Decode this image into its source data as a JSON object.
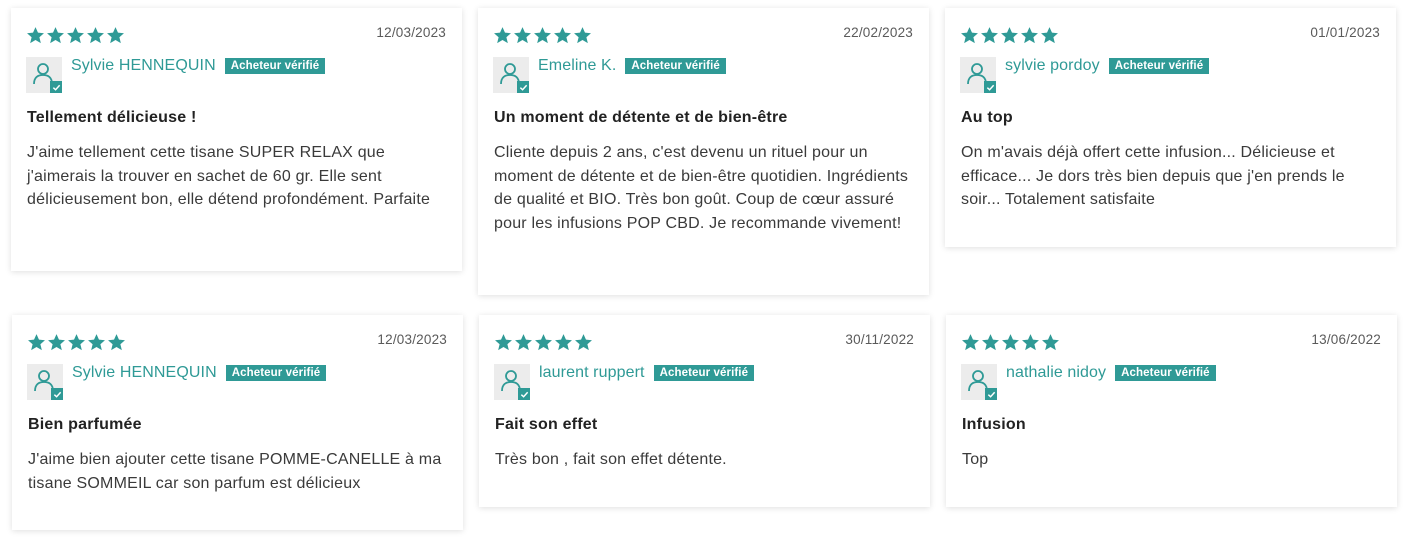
{
  "colors": {
    "accent": "#2f9a96",
    "star": "#2f9a96"
  },
  "badge_label": "Acheteur vérifié",
  "reviews": [
    {
      "rating": 5,
      "date": "12/03/2023",
      "author": "Sylvie HENNEQUIN",
      "title": "Tellement délicieuse !",
      "body": "J'aime tellement cette tisane SUPER RELAX que j'aimerais la trouver en sachet de 60 gr. Elle sent délicieusement bon, elle détend profondément. Parfaite"
    },
    {
      "rating": 5,
      "date": "22/02/2023",
      "author": "Emeline K.",
      "title": "Un moment de détente et de bien-être",
      "body": "Cliente depuis 2 ans, c'est devenu un rituel pour un moment de détente et de bien-être quotidien. Ingrédients de qualité et BIO. Très bon goût. Coup de cœur assuré pour les infusions POP CBD. Je recommande vivement!"
    },
    {
      "rating": 5,
      "date": "01/01/2023",
      "author": "sylvie pordoy",
      "title": "Au top",
      "body": "On m'avais déjà offert cette infusion... Délicieuse et efficace... Je dors très bien depuis que j'en prends le soir... Totalement satisfaite"
    },
    {
      "rating": 5,
      "date": "12/03/2023",
      "author": "Sylvie HENNEQUIN",
      "title": "Bien parfumée",
      "body": "J'aime bien ajouter cette tisane POMME-CANELLE à ma tisane SOMMEIL car son parfum est délicieux"
    },
    {
      "rating": 5,
      "date": "30/11/2022",
      "author": "laurent ruppert",
      "title": "Fait son effet",
      "body": "Très bon , fait son effet détente."
    },
    {
      "rating": 5,
      "date": "13/06/2022",
      "author": "nathalie nidoy",
      "title": "Infusion",
      "body": "Top"
    }
  ]
}
